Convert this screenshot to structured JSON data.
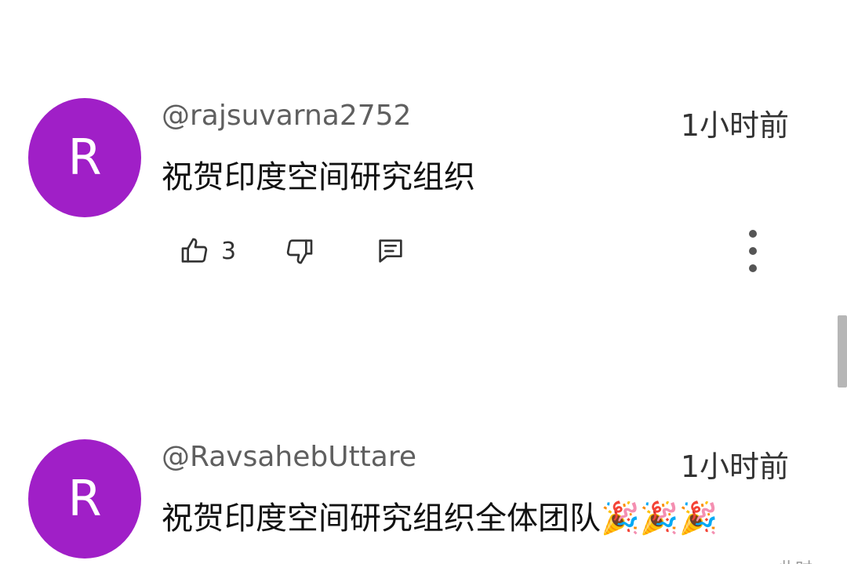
{
  "comments": [
    {
      "avatar_letter": "R",
      "avatar_color": "#a01fc7",
      "username": "@rajsuvarna2752",
      "timestamp": "1小时前",
      "text": "祝贺印度空间研究组织",
      "like_count": "3",
      "icons": [
        "thumb-up-icon",
        "thumb-down-icon",
        "reply-icon",
        "more-vert-icon"
      ]
    },
    {
      "avatar_letter": "R",
      "avatar_color": "#a01fc7",
      "username": "@RavsahebUttare",
      "timestamp": "1小时前",
      "text": "祝贺印度空间研究组织全体团队🎉🎉🎉"
    }
  ],
  "bottom_snippet": "此时…"
}
